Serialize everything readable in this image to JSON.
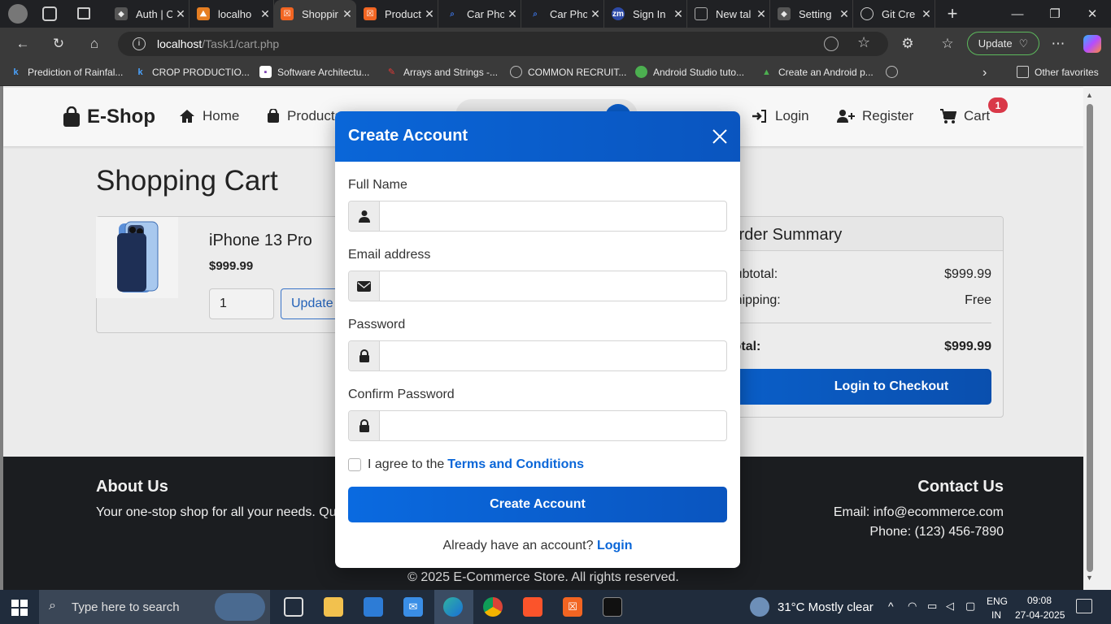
{
  "browser": {
    "tabs": [
      {
        "title": "Auth | C",
        "favicon": "shield-icon",
        "color": "#555555",
        "active": false
      },
      {
        "title": "localho",
        "favicon": "xampp-icon",
        "color": "#e67e22",
        "active": false
      },
      {
        "title": "Shoppir",
        "favicon": "xampp-icon",
        "color": "#f26522",
        "active": true
      },
      {
        "title": "Product",
        "favicon": "xampp-icon",
        "color": "#f26522",
        "active": false
      },
      {
        "title": "Car Pho",
        "favicon": "search-icon",
        "color": "#3a6fd8",
        "active": false
      },
      {
        "title": "Car Pho",
        "favicon": "search-icon",
        "color": "#3a6fd8",
        "active": false
      },
      {
        "title": "Sign In",
        "favicon": "zm-icon",
        "color": "#2d4aa8",
        "active": false
      },
      {
        "title": "New tal",
        "favicon": "newtab-icon",
        "color": "#888888",
        "active": false
      },
      {
        "title": "Setting",
        "favicon": "shield-icon",
        "color": "#555555",
        "active": false
      },
      {
        "title": "Git Cre",
        "favicon": "globe-icon",
        "color": "#888888",
        "active": false
      }
    ],
    "url_host": "localhost",
    "url_path": "/Task1/cart.php",
    "update_label": "Update",
    "bookmarks": [
      {
        "label": "Prediction of Rainfal...",
        "icon": "k-icon",
        "color": "#1a73e8"
      },
      {
        "label": "CROP PRODUCTIO...",
        "icon": "k-icon",
        "color": "#1a73e8"
      },
      {
        "label": "Software Architectu...",
        "icon": "doc-icon",
        "color": "#ffffff"
      },
      {
        "label": "Arrays and Strings -...",
        "icon": "bookmark-icon",
        "color": "#d32f2f"
      },
      {
        "label": "COMMON RECRUIT...",
        "icon": "globe-icon",
        "color": "#aaaaaa"
      },
      {
        "label": "Android Studio tuto...",
        "icon": "android-icon",
        "color": "#4caf50"
      },
      {
        "label": "Create an Android p...",
        "icon": "android-icon",
        "color": "#4caf50"
      }
    ],
    "other_favorites": "Other favorites"
  },
  "site": {
    "brand": "E-Shop",
    "nav": {
      "home": "Home",
      "products": "Products",
      "login": "Login",
      "register": "Register",
      "cart": "Cart",
      "cart_count": "1"
    },
    "cart_title": "Shopping Cart",
    "item": {
      "name": "iPhone 13 Pro",
      "price": "$999.99",
      "quantity": "1",
      "update_label": "Update"
    },
    "summary": {
      "title": "Order Summary",
      "subtotal_label": "Subtotal:",
      "subtotal_value": "$999.99",
      "shipping_label": "Shipping:",
      "shipping_value": "Free",
      "total_label": "Total:",
      "total_value": "$999.99",
      "checkout_label": "Login to Checkout"
    },
    "footer": {
      "about_title": "About Us",
      "about_text": "Your one-stop shop for all your needs. Qu",
      "contact_title": "Contact Us",
      "email": "Email: info@ecommerce.com",
      "phone": "Phone: (123) 456-7890",
      "copyright": "© 2025 E-Commerce Store. All rights reserved."
    }
  },
  "modal": {
    "title": "Create Account",
    "full_name_label": "Full Name",
    "email_label": "Email address",
    "password_label": "Password",
    "confirm_label": "Confirm Password",
    "full_name_value": "",
    "email_value": "",
    "password_value": "",
    "confirm_value": "",
    "terms_prefix": "I agree to the",
    "terms_link": "Terms and Conditions",
    "submit_label": "Create Account",
    "login_prompt": "Already have an account?",
    "login_link": "Login"
  },
  "taskbar": {
    "search_placeholder": "Type here to search",
    "weather": "31°C  Mostly clear",
    "lang_top": "ENG",
    "lang_bottom": "IN",
    "time": "09:08",
    "date": "27-04-2025"
  }
}
